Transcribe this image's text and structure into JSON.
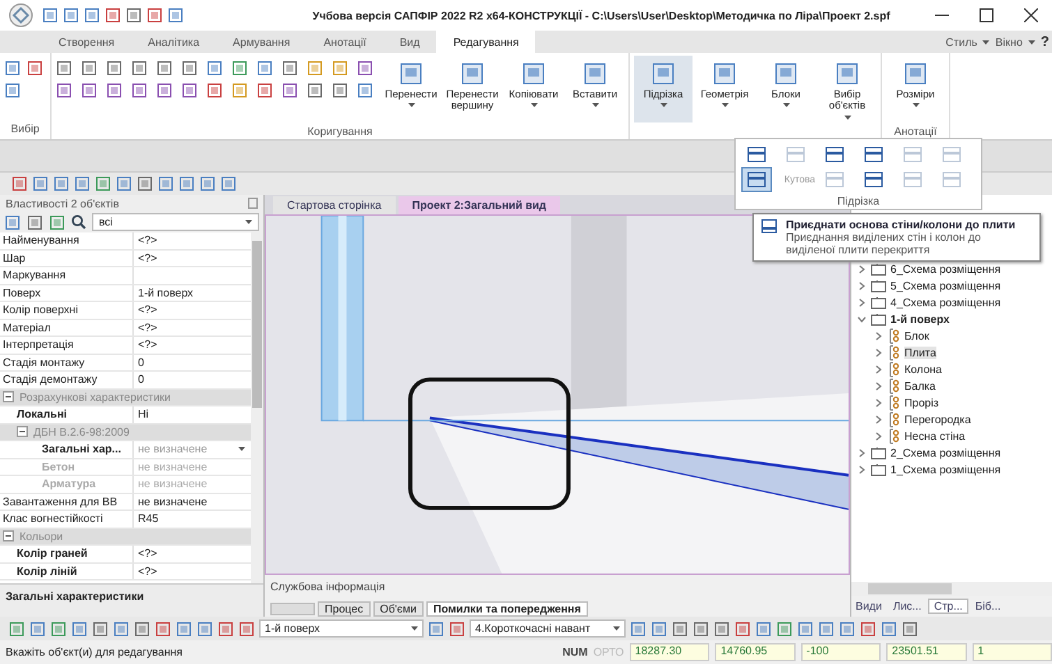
{
  "window": {
    "title": "Учбова версія САПФІР 2022 R2 x64-КОНСТРУКЦІЇ - C:\\Users\\User\\Desktop\\Методичка по Ліра\\Проект 2.spf"
  },
  "ribbon": {
    "tabs": [
      {
        "label": "Створення",
        "selected": false
      },
      {
        "label": "Аналітика",
        "selected": false
      },
      {
        "label": "Армування",
        "selected": false
      },
      {
        "label": "Анотації",
        "selected": false
      },
      {
        "label": "Вид",
        "selected": false
      },
      {
        "label": "Редагування",
        "selected": true
      }
    ],
    "menus": [
      "Стиль",
      "Вікно"
    ],
    "help": "?",
    "groups": [
      {
        "label": "Вибір"
      },
      {
        "label": "Коригування",
        "buttons": [
          {
            "label": "Перенести",
            "dropdown": true,
            "selected": false
          },
          {
            "label": "Перенести вершину",
            "dropdown": false,
            "selected": false
          },
          {
            "label": "Копіювати",
            "dropdown": true,
            "selected": false
          },
          {
            "label": "Вставити",
            "dropdown": true,
            "selected": false
          }
        ]
      },
      {
        "buttons": [
          {
            "label": "Підрізка",
            "dropdown": true,
            "selected": true
          },
          {
            "label": "Геометрія",
            "dropdown": true,
            "selected": false
          },
          {
            "label": "Блоки",
            "dropdown": true,
            "selected": false
          },
          {
            "label": "Вибір об'єктів",
            "dropdown": true,
            "selected": false
          }
        ]
      },
      {
        "label": "Анотації",
        "buttons": [
          {
            "label": "Розміри",
            "dropdown": true,
            "selected": false
          }
        ]
      }
    ]
  },
  "trim_menu": {
    "label": "Підрізка",
    "tools": [
      {
        "selected": false,
        "disabled": false
      },
      {
        "selected": false,
        "disabled": true
      },
      {
        "selected": false,
        "disabled": false
      },
      {
        "selected": false,
        "disabled": false
      },
      {
        "selected": false,
        "disabled": true
      },
      {
        "selected": false,
        "disabled": true
      },
      {
        "selected": true,
        "disabled": false
      },
      {
        "label": "Кутова",
        "selected": false,
        "disabled": true
      },
      {
        "selected": false,
        "disabled": true
      },
      {
        "selected": false,
        "disabled": false
      },
      {
        "selected": false,
        "disabled": true
      },
      {
        "selected": false,
        "disabled": true
      }
    ]
  },
  "tooltip": {
    "title": "Приєднати основа стіни/колони до плити",
    "text": "Приєднання виділених стін і колон до виділеної плити перекриття"
  },
  "properties": {
    "title": "Властивості 2 об'єктів",
    "filter": "всі",
    "rows": [
      {
        "kind": "row",
        "name": "Найменування",
        "value": "<?>",
        "disabled": false
      },
      {
        "kind": "row",
        "name": "Шар",
        "value": "<?>",
        "disabled": false
      },
      {
        "kind": "row",
        "name": "Маркування",
        "value": "",
        "disabled": false
      },
      {
        "kind": "row",
        "name": "Поверх",
        "value": "1-й поверх",
        "disabled": false
      },
      {
        "kind": "row",
        "name": "Колір поверхні",
        "value": "<?>",
        "disabled": false
      },
      {
        "kind": "row",
        "name": "Матеріал",
        "value": "<?>",
        "disabled": false
      },
      {
        "kind": "row",
        "name": "Інтерпретація",
        "value": "<?>",
        "disabled": false
      },
      {
        "kind": "row",
        "name": "Стадія монтажу",
        "value": "0",
        "disabled": false
      },
      {
        "kind": "row",
        "name": "Стадія демонтажу",
        "value": "0",
        "disabled": false
      },
      {
        "kind": "section",
        "name": "Розрахункові характеристики",
        "expanded": true,
        "children": [
          {
            "kind": "row",
            "name": "Локальні",
            "value": "Ні",
            "disabled": false
          },
          {
            "kind": "section",
            "name": "ДБН В.2.6-98:2009",
            "expanded": true,
            "children": [
              {
                "kind": "select",
                "name": "Загальні хар...",
                "value": "не визначене",
                "disabled": false
              },
              {
                "kind": "row",
                "name": "Бетон",
                "value": "не визначене",
                "disabled": true
              },
              {
                "kind": "row",
                "name": "Арматура",
                "value": "не визначене",
                "disabled": true
              }
            ]
          }
        ]
      },
      {
        "kind": "row",
        "name": "Завантаження для ВВ",
        "value": "не визначене",
        "disabled": false
      },
      {
        "kind": "row",
        "name": "Клас вогнестійкості",
        "value": "R45",
        "disabled": false
      },
      {
        "kind": "section",
        "name": "Кольори",
        "expanded": true,
        "children": [
          {
            "kind": "row",
            "name": "Колір граней",
            "value": "<?>",
            "disabled": false
          },
          {
            "kind": "row",
            "name": "Колір ліній",
            "value": "<?>",
            "disabled": false
          }
        ]
      }
    ],
    "footer": "Загальні характеристики"
  },
  "document_tabs": [
    {
      "label": "Стартова сторінка",
      "selected": false
    },
    {
      "label": "Проект 2:Загальний вид",
      "selected": true
    }
  ],
  "service_panel": {
    "title": "Службова інформація",
    "tabs": [
      {
        "label": "Процес",
        "selected": false
      },
      {
        "label": "Об'єми",
        "selected": false
      },
      {
        "label": "Помилки та попередження",
        "selected": true
      }
    ]
  },
  "project_tree": {
    "items": [
      {
        "kind": "floor",
        "label": "6_Схема розміщення",
        "expanded": false,
        "active": false,
        "selected": false
      },
      {
        "kind": "floor",
        "label": "5_Схема розміщення",
        "expanded": false,
        "active": false,
        "selected": false
      },
      {
        "kind": "floor",
        "label": "4_Схема розміщення",
        "expanded": false,
        "active": false,
        "selected": false
      },
      {
        "kind": "floor",
        "label": "1-й поверх",
        "expanded": true,
        "active": true,
        "selected": false,
        "children": [
          {
            "kind": "layer",
            "label": "Блок",
            "expanded": false,
            "active": false,
            "selected": false
          },
          {
            "kind": "layer",
            "label": "Плита",
            "expanded": false,
            "active": false,
            "selected": true
          },
          {
            "kind": "layer",
            "label": "Колона",
            "expanded": false,
            "active": false,
            "selected": false
          },
          {
            "kind": "layer",
            "label": "Балка",
            "expanded": false,
            "active": false,
            "selected": false
          },
          {
            "kind": "layer",
            "label": "Проріз",
            "expanded": false,
            "active": false,
            "selected": false
          },
          {
            "kind": "layer",
            "label": "Перегородка",
            "expanded": false,
            "active": false,
            "selected": false
          },
          {
            "kind": "layer",
            "label": "Несна стіна",
            "expanded": false,
            "active": false,
            "selected": false
          }
        ]
      },
      {
        "kind": "floor",
        "label": "2_Схема розміщення",
        "expanded": false,
        "active": false,
        "selected": false
      },
      {
        "kind": "floor",
        "label": "1_Схема розміщення",
        "expanded": false,
        "active": false,
        "selected": false
      }
    ]
  },
  "panel_tabs": [
    {
      "label": "Види",
      "selected": false
    },
    {
      "label": "Лис...",
      "selected": false
    },
    {
      "label": "Стр...",
      "selected": true
    },
    {
      "label": "Біб...",
      "selected": false
    }
  ],
  "bottom_toolbar": {
    "floor": "1-й поверх",
    "load_case": "4.Короткочасні навант"
  },
  "status_bar": {
    "message": "Вкажіть об'єкт(и) для редагування",
    "indicators": [
      {
        "label": "NUM",
        "on": true
      },
      {
        "label": "ОРТО",
        "on": false
      }
    ],
    "fields": [
      "18287.30",
      "14760.95",
      "-100",
      "23501.51",
      "1"
    ]
  }
}
